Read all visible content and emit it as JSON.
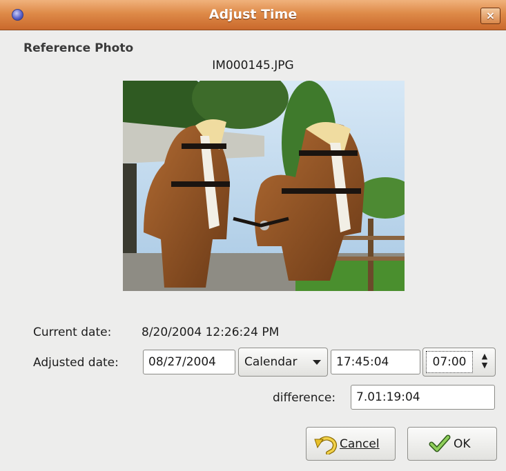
{
  "window": {
    "title": "Adjust Time",
    "close_label": "×"
  },
  "reference": {
    "heading": "Reference Photo",
    "filename": "IM000145.JPG"
  },
  "current": {
    "label": "Current date:",
    "value": "8/20/2004 12:26:24 PM"
  },
  "adjusted": {
    "label": "Adjusted date:",
    "date": "08/27/2004",
    "calendar_button": "Calendar",
    "time": "17:45:04",
    "spin_value": "07:00"
  },
  "difference": {
    "label": "difference:",
    "value": "7.01:19:04"
  },
  "buttons": {
    "cancel": "Cancel",
    "ok": "OK"
  },
  "icons": {
    "window_menu": "window-menu-icon",
    "close": "close-icon",
    "calendar_arrow": "chevron-down-icon",
    "spin": "spinner-arrows-icon",
    "cancel": "undo-arrow-icon",
    "ok": "check-icon"
  }
}
